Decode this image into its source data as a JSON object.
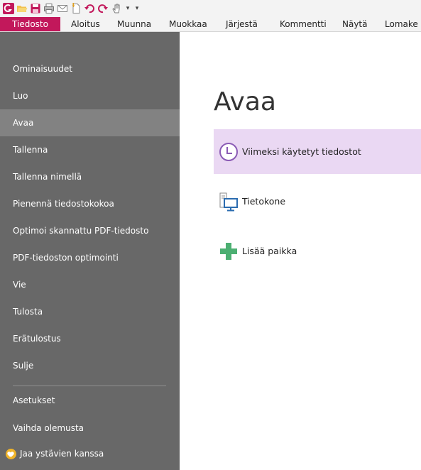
{
  "menubar": {
    "tabs": [
      {
        "label": "Tiedosto",
        "active": true
      },
      {
        "label": "Aloitus"
      },
      {
        "label": "Muunna"
      },
      {
        "label": "Muokkaa"
      },
      {
        "label": "Järjestä"
      },
      {
        "label": "Kommentti"
      },
      {
        "label": "Näytä"
      },
      {
        "label": "Lomake"
      }
    ]
  },
  "sidebar": {
    "items": [
      {
        "label": "Ominaisuudet"
      },
      {
        "label": "Luo"
      },
      {
        "label": "Avaa",
        "active": true
      },
      {
        "label": "Tallenna"
      },
      {
        "label": "Tallenna nimellä"
      },
      {
        "label": "Pienennä tiedostokokoa"
      },
      {
        "label": "Optimoi skannattu PDF-tiedosto"
      },
      {
        "label": "PDF-tiedoston optimointi"
      },
      {
        "label": "Vie"
      },
      {
        "label": "Tulosta"
      },
      {
        "label": "Erätulostus"
      },
      {
        "label": "Sulje"
      },
      {
        "label": "Asetukset"
      },
      {
        "label": "Vaihda olemusta"
      },
      {
        "label": "Jaa ystävien kanssa"
      }
    ]
  },
  "main": {
    "title": "Avaa",
    "options": [
      {
        "label": "Viimeksi käytetyt tiedostot",
        "icon": "clock-icon",
        "selected": true
      },
      {
        "label": "Tietokone",
        "icon": "computer-icon"
      },
      {
        "label": "Lisää paikka",
        "icon": "plus-icon"
      }
    ]
  },
  "colors": {
    "accent": "#c2185b",
    "sidebar_bg": "#686868",
    "sidebar_active": "#828282",
    "selected_option": "#ead8f3",
    "plus_green": "#4caf72"
  }
}
